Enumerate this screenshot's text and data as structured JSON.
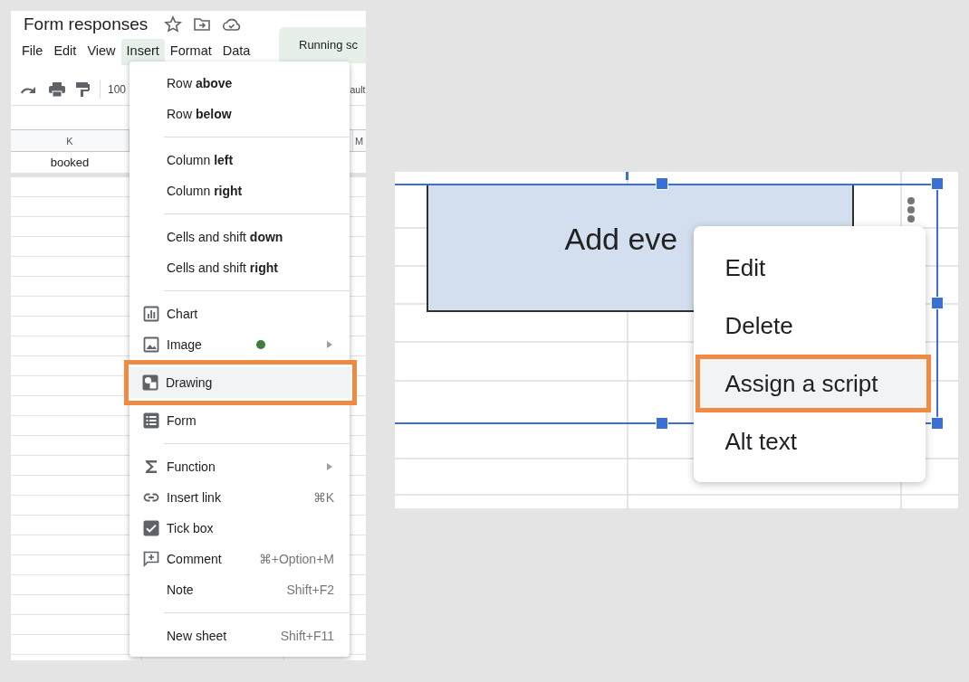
{
  "spreadsheet": {
    "title": "Form responses",
    "menu_bar": [
      {
        "label": "File",
        "selected": false
      },
      {
        "label": "Edit",
        "selected": false
      },
      {
        "label": "View",
        "selected": false
      },
      {
        "label": "Insert",
        "selected": true
      },
      {
        "label": "Format",
        "selected": false
      },
      {
        "label": "Data",
        "selected": false
      }
    ],
    "toast": "Running sc",
    "toolbar": {
      "zoom": "100",
      "font": "ault"
    },
    "column_headers": [
      "K",
      "M"
    ],
    "cells": [
      "booked"
    ]
  },
  "insert_menu": {
    "items": [
      {
        "kind": "plain",
        "label": "Row **above**",
        "selected": false
      },
      {
        "kind": "plain",
        "label": "Row **below**",
        "selected": false
      },
      {
        "kind": "separator"
      },
      {
        "kind": "plain",
        "label": "Column **left**",
        "selected": false
      },
      {
        "kind": "plain",
        "label": "Column **right**",
        "selected": false
      },
      {
        "kind": "separator"
      },
      {
        "kind": "plain",
        "label": "Cells and shift **down**",
        "selected": false
      },
      {
        "kind": "plain",
        "label": "Cells and shift **right**",
        "selected": false
      },
      {
        "kind": "separator"
      },
      {
        "kind": "chart",
        "label": "Chart",
        "selected": false
      },
      {
        "kind": "image",
        "label": "Image",
        "selected": false,
        "new_dot": true,
        "submenu": true
      },
      {
        "kind": "drawing",
        "label": "Drawing",
        "selected": true
      },
      {
        "kind": "form",
        "label": "Form",
        "selected": false
      },
      {
        "kind": "separator"
      },
      {
        "kind": "function",
        "label": "Function",
        "selected": false,
        "submenu": true
      },
      {
        "kind": "link",
        "label": "Insert link",
        "selected": false,
        "shortcut": "⌘K"
      },
      {
        "kind": "tickbox",
        "label": "Tick box",
        "selected": false
      },
      {
        "kind": "comment",
        "label": "Comment",
        "selected": false,
        "shortcut": "⌘+Option+M"
      },
      {
        "kind": "plain",
        "label": "Note",
        "selected": false,
        "shortcut": "Shift+F2"
      },
      {
        "kind": "separator"
      },
      {
        "kind": "plain",
        "label": "New sheet",
        "selected": false,
        "shortcut": "Shift+F11"
      }
    ]
  },
  "drawing_canvas": {
    "shape_text": "Add eve",
    "context_menu": [
      {
        "label": "Edit",
        "selected": false
      },
      {
        "label": "Delete",
        "selected": false
      },
      {
        "label": "Assign a script",
        "selected": true
      },
      {
        "label": "Alt text",
        "selected": false
      }
    ]
  }
}
